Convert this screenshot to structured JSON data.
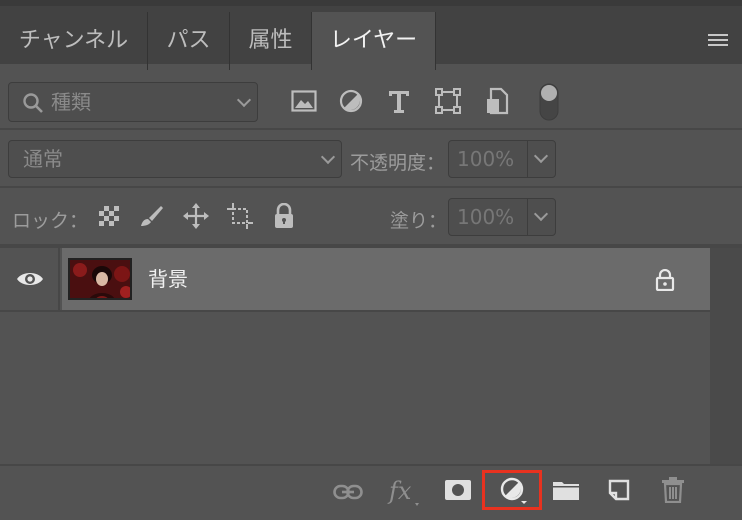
{
  "tabs": [
    {
      "label": "チャンネル"
    },
    {
      "label": "パス"
    },
    {
      "label": "属性"
    },
    {
      "label": "レイヤー"
    }
  ],
  "active_tab": "レイヤー",
  "filter": {
    "placeholder": "種類"
  },
  "blend_mode": {
    "value": "通常"
  },
  "opacity": {
    "label": "不透明度：",
    "value": "100%"
  },
  "lock": {
    "label": "ロック："
  },
  "fill": {
    "label": "塗り：",
    "value": "100%"
  },
  "layers": [
    {
      "name": "背景",
      "visible": true,
      "locked": true
    }
  ],
  "colors": {
    "highlight": "#e8321f",
    "selected_row": "#6b6b6b"
  }
}
